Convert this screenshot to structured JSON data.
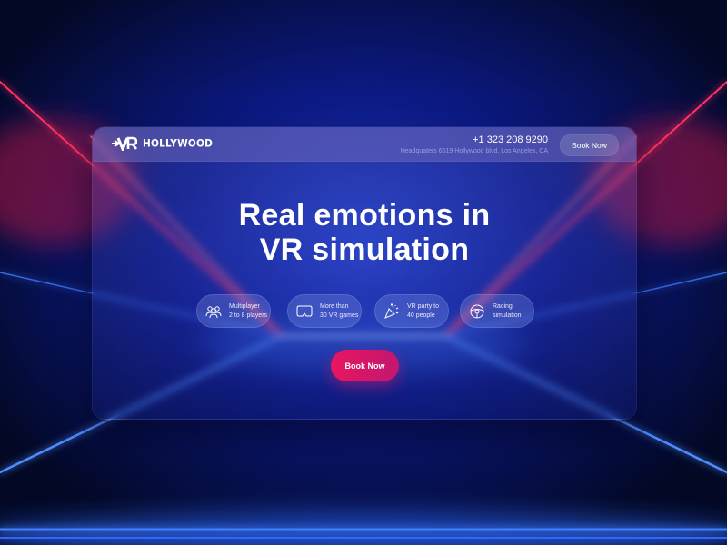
{
  "brand": {
    "name": "HOLLYWOOD",
    "logo_mark": "VR"
  },
  "header": {
    "phone": "+1 323 208 9290",
    "address": "Headquaters 6519 Hollywood blvd, Los Angeles, CA",
    "book_label": "Book Now"
  },
  "hero": {
    "headline_line1": "Real emotions in",
    "headline_line2": "VR simulation"
  },
  "features": [
    {
      "icon": "players-icon",
      "line1": "Multiplayer",
      "line2": "2 to 8 players"
    },
    {
      "icon": "vr-headset-icon",
      "line1": "More than",
      "line2": "30 VR games"
    },
    {
      "icon": "party-popper-icon",
      "line1": "VR party to",
      "line2": "40 people"
    },
    {
      "icon": "steering-wheel-icon",
      "line1": "Racing",
      "line2": "simulation"
    }
  ],
  "cta": {
    "book_label": "Book Now"
  },
  "colors": {
    "background": "#040b3a",
    "neon_blue": "#3d7bff",
    "neon_red": "#ff2a55",
    "cta_pink": "#e8165f"
  }
}
